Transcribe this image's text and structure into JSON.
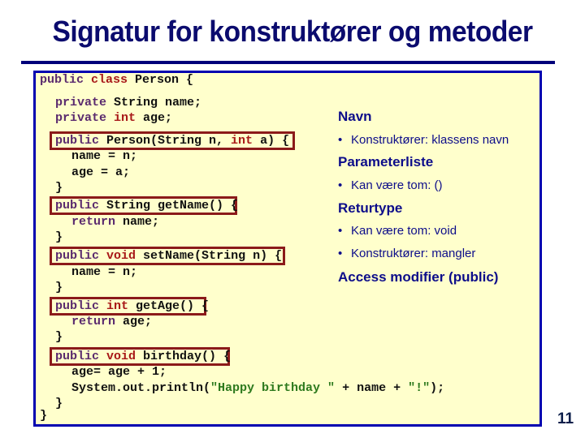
{
  "slide": {
    "title": "Signatur for konstruktører og metoder",
    "page_number": "11"
  },
  "code": {
    "l1": {
      "kw": "public",
      "kw2": "class",
      "rest": " Person {"
    },
    "l2": {
      "kw": "private",
      "rest": " String name;"
    },
    "l3": {
      "kw": "private",
      "kw2": "int",
      "rest": " age;"
    },
    "l4": {
      "kw": "public",
      "a": " Person(String n, ",
      "kw2": "int",
      "b": " a) {"
    },
    "l5": "name = n;",
    "l6": "age = a;",
    "l7": "}",
    "l8": {
      "kw": "public",
      "rest": " String getName() {"
    },
    "l9": {
      "kw": "return",
      "rest": " name;"
    },
    "l10": "}",
    "l11": {
      "kw": "public",
      "kw2": "void",
      "rest": " setName(String n) {"
    },
    "l12": "name = n;",
    "l13": "}",
    "l14": {
      "kw": "public",
      "kw2": "int",
      "rest": " getAge() {"
    },
    "l15": {
      "kw": "return",
      "rest": " age;"
    },
    "l16": "}",
    "l17": {
      "kw": "public",
      "kw2": "void",
      "rest": " birthday() {"
    },
    "l18": "age= age + 1;",
    "l19": {
      "a": "System.out.println(",
      "s1": "\"Happy birthday \"",
      "b": " + name + ",
      "s2": "\"!\"",
      "c": ");"
    },
    "l20": "}",
    "l21": "}"
  },
  "notes": {
    "navn": "Navn",
    "navn_b1": "Konstruktører: klassens navn",
    "param": "Parameterliste",
    "param_b1": "Kan være tom: ()",
    "retur": "Returtype",
    "retur_b1": "Kan være tom: void",
    "retur_b2": "Konstruktører: mangler",
    "access": "Access modifier (public)",
    "bullet": "•"
  }
}
